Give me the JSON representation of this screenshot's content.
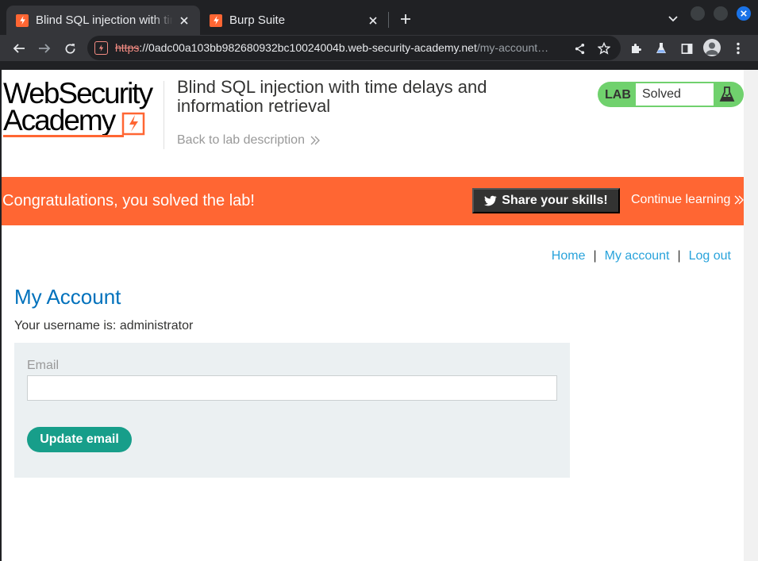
{
  "browser": {
    "tabs": [
      {
        "title": "Blind SQL injection with time delays",
        "active": true
      },
      {
        "title": "Burp Suite",
        "active": false
      }
    ],
    "url": {
      "scheme": "https",
      "host": "://0adc00a103bb982680932bc10024004b.web-security-academy.net",
      "path": "/my-account…"
    }
  },
  "header": {
    "logo_line1": "WebSecurity",
    "logo_line2": "Academy",
    "lab_title": "Blind SQL injection with time delays and information retrieval",
    "back_link": "Back to lab description",
    "lab_label": "LAB",
    "lab_status": "Solved"
  },
  "banner": {
    "message": "Congratulations, you solved the lab!",
    "share_label": "Share your skills!",
    "continue_label": "Continue learning"
  },
  "nav": {
    "home": "Home",
    "my_account": "My account",
    "logout": "Log out",
    "separator": "|"
  },
  "account": {
    "title": "My Account",
    "username_line": "Your username is: administrator",
    "email_label": "Email",
    "email_value": "",
    "update_label": "Update email"
  },
  "colors": {
    "brand_orange": "#ff6633",
    "link_blue": "#29a3db",
    "title_blue": "#0071bc",
    "button_teal": "#179e8a",
    "lab_green": "#70d16d"
  }
}
